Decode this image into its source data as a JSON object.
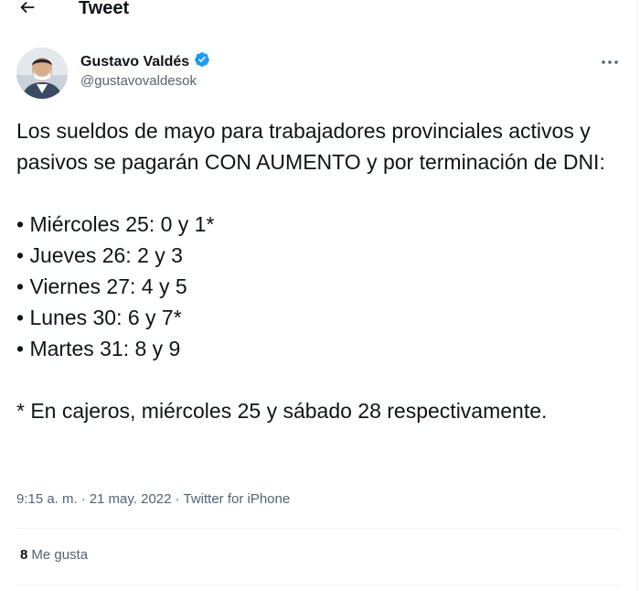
{
  "header": {
    "title": "Tweet",
    "back_icon": "arrow-left-icon"
  },
  "author": {
    "name": "Gustavo Valdés",
    "handle": "@gustavovaldesok",
    "verified_icon": "verified-badge-icon",
    "verified_color": "#1d9bf0"
  },
  "more_icon": "more-horizontal-icon",
  "tweet": {
    "text": "Los sueldos de mayo para trabajadores provinciales activos y pasivos se pagarán CON AUMENTO y por terminación de DNI:\n\n• Miércoles 25: 0 y 1*\n• Jueves 26: 2 y 3\n• Viernes 27: 4 y 5\n• Lunes 30: 6 y 7*\n• Martes 31: 8 y 9\n\n* En cajeros, miércoles 25 y sábado 28 respectivamente."
  },
  "meta": {
    "time": "9:15 a. m.",
    "separator": "·",
    "date": "21 may. 2022",
    "source": "Twitter for iPhone"
  },
  "stats": {
    "likes_count": "8",
    "likes_label": "Me gusta"
  },
  "colors": {
    "text": "#0f1419",
    "secondary": "#536471",
    "divider": "#eff3f4",
    "accent": "#1d9bf0"
  }
}
